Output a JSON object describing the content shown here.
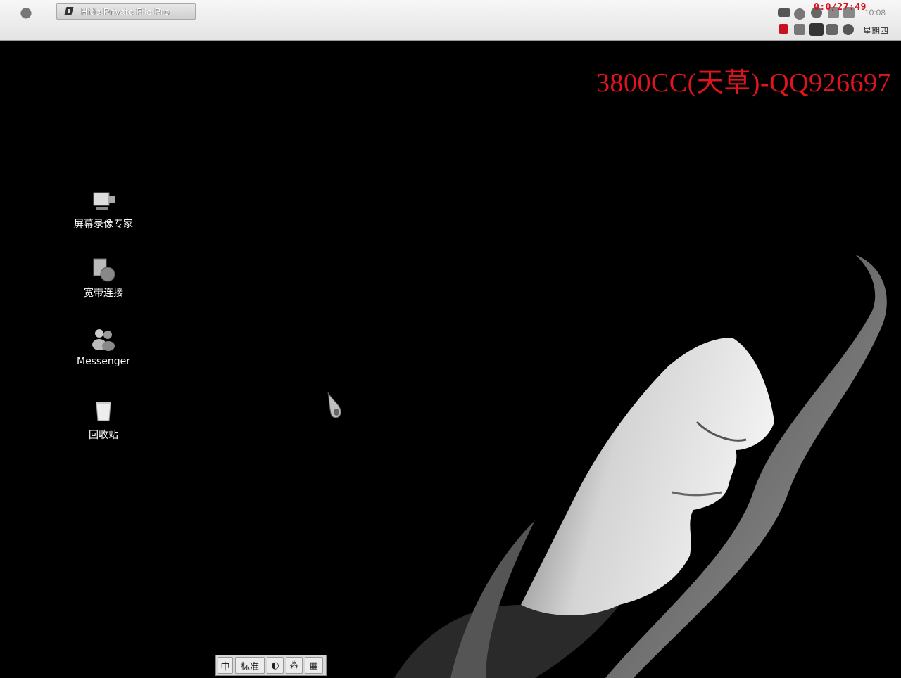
{
  "menubar": {
    "apple_icon": "apple-icon",
    "active_task": {
      "icon": "app-icon",
      "label": "Hide Private File Pro"
    }
  },
  "tray": {
    "timer": "0:0/27:49",
    "clock": "10:08",
    "weekday": "星期四"
  },
  "watermark": "3800CC(天草)-QQ926697",
  "desktop_icons": [
    {
      "label": "屏幕录像专家",
      "icon": "screen-recorder-icon"
    },
    {
      "label": "宽带连接",
      "icon": "broadband-connection-icon"
    },
    {
      "label": "Messenger",
      "icon": "messenger-icon"
    },
    {
      "label": "回收站",
      "icon": "recycle-bin-icon"
    }
  ],
  "ime_bar": {
    "mode": "中",
    "layout": "标准",
    "punct_icon": "punctuation-icon",
    "width_icon": "half-width-icon",
    "keyboard_icon": "soft-keyboard-icon"
  }
}
